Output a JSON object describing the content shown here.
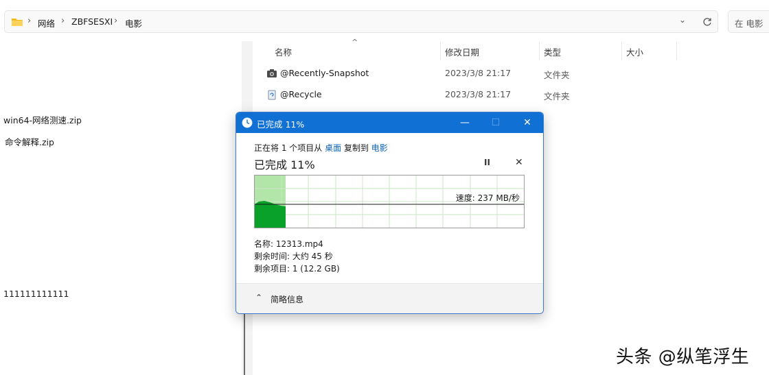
{
  "breadcrumb": [
    "网络",
    "ZBFSESXI",
    "电影"
  ],
  "search_placeholder": "在 电影",
  "left_files": [
    "win64-网络测速.zip",
    "命令解释.zip",
    "111111111111"
  ],
  "columns": [
    "名称",
    "修改日期",
    "类型",
    "大小"
  ],
  "files": [
    {
      "name": "@Recently-Snapshot",
      "date": "2023/3/8 21:17",
      "type": "文件夹",
      "icon": "camera-icon"
    },
    {
      "name": "@Recycle",
      "date": "2023/3/8 21:17",
      "type": "文件夹",
      "icon": "recycle-icon"
    }
  ],
  "dialog": {
    "title": "已完成 11%",
    "copy_prefix": "正在将 1 个项目从",
    "source": "桌面",
    "copy_mid": "复制到",
    "dest": "电影",
    "percent_text": "已完成 11%",
    "progress": 0.11,
    "speed": "速度: 237 MB/秒",
    "name_line": "名称: 12313.mp4",
    "time_line": "剩余时间: 大约 45 秒",
    "items_line": "剩余项目: 1 (12.2 GB)",
    "less_details": "简略信息"
  },
  "watermark": "头条 @纵笔浮生"
}
